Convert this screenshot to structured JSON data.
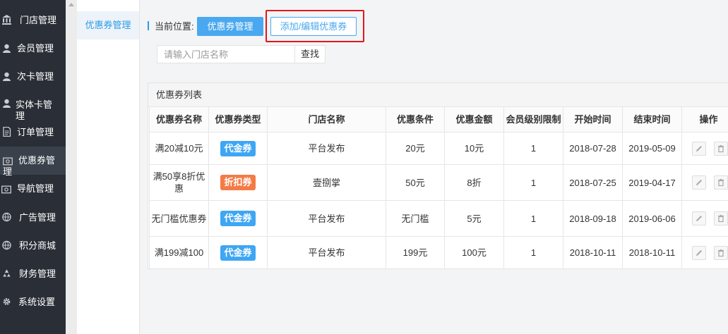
{
  "sidebar": {
    "items": [
      {
        "label": "门店管理",
        "icon": "bank-icon"
      },
      {
        "label": "会员管理",
        "icon": "user-icon"
      },
      {
        "label": "次卡管理",
        "icon": "user-icon"
      },
      {
        "label": "实体卡管理",
        "icon": "user-icon"
      },
      {
        "label": "订单管理",
        "icon": "document-icon"
      },
      {
        "label": "优惠券管理",
        "icon": "money-icon"
      },
      {
        "label": "导航管理",
        "icon": "money-icon"
      },
      {
        "label": "广告管理",
        "icon": "globe-icon"
      },
      {
        "label": "积分商城",
        "icon": "globe-icon"
      },
      {
        "label": "财务管理",
        "icon": "recycle-icon"
      },
      {
        "label": "系统设置",
        "icon": "gear-icon"
      }
    ]
  },
  "subsidebar": {
    "item": "优惠券管理"
  },
  "breadcrumb": {
    "label": "当前位置:",
    "current": "优惠券管理",
    "action": "添加/编辑优惠券"
  },
  "search": {
    "placeholder": "请输入门店名称",
    "button": "查找"
  },
  "panel": {
    "title": "优惠券列表"
  },
  "table": {
    "headers": [
      "优惠券名称",
      "优惠券类型",
      "门店名称",
      "优惠条件",
      "优惠金额",
      "会员级别限制",
      "开始时间",
      "结束时间",
      "操作"
    ],
    "rows": [
      {
        "name": "满20减10元",
        "type": "代金券",
        "store": "平台发布",
        "condition": "20元",
        "amount": "10元",
        "level": "1",
        "start": "2018-07-28",
        "end": "2019-05-09"
      },
      {
        "name": "满50享8折优惠",
        "type": "折扣券",
        "store": "壹捌掌",
        "condition": "50元",
        "amount": "8折",
        "level": "1",
        "start": "2018-07-25",
        "end": "2019-04-17"
      },
      {
        "name": "无门槛优惠券",
        "type": "代金券",
        "store": "平台发布",
        "condition": "无门槛",
        "amount": "5元",
        "level": "1",
        "start": "2018-09-18",
        "end": "2019-06-06"
      },
      {
        "name": "满199减100",
        "type": "代金券",
        "store": "平台发布",
        "condition": "199元",
        "amount": "100元",
        "level": "1",
        "start": "2018-10-11",
        "end": "2018-10-11"
      }
    ]
  },
  "colors": {
    "voucher_tag": "#3ea6f3",
    "discount_tag": "#f47b45",
    "accent": "#49a8ef",
    "highlight": "#e0181d"
  }
}
